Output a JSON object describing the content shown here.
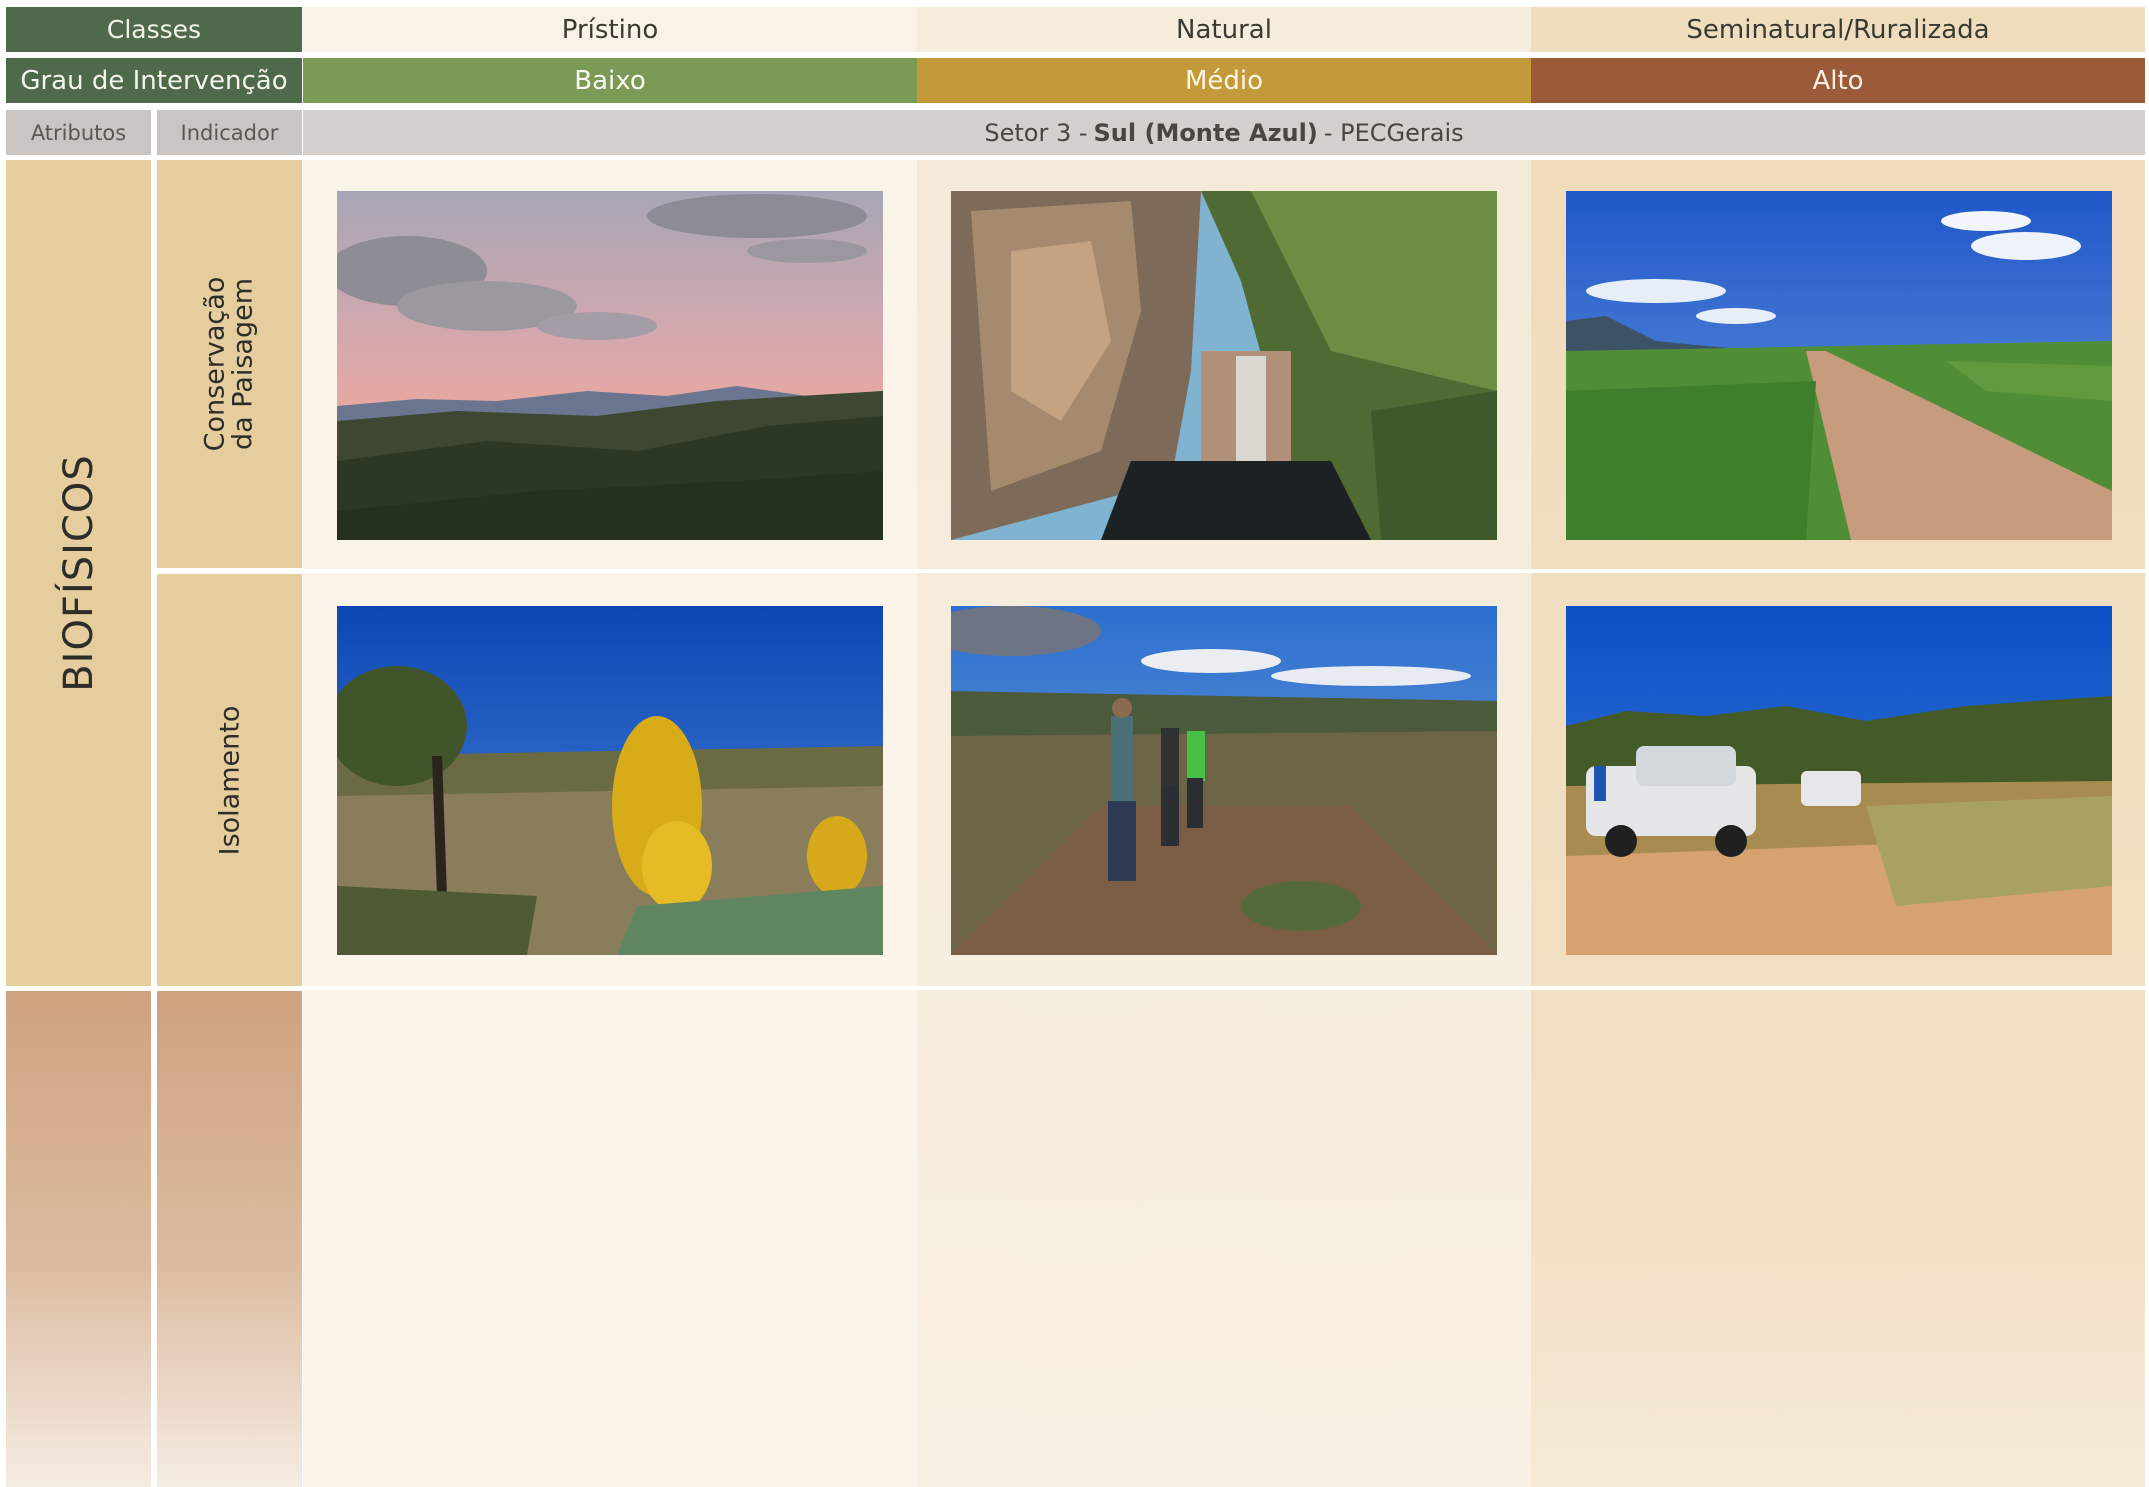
{
  "header": {
    "classes_label": "Classes",
    "classes": [
      "Prístino",
      "Natural",
      "Seminatural/Ruralizada"
    ],
    "grau_label": "Grau de Intervenção",
    "graus": [
      "Baixo",
      "Médio",
      "Alto"
    ],
    "atributos_label": "Atributos",
    "indicador_label": "Indicador",
    "setor": {
      "prefix": "Setor 3 -",
      "name": "Sul (Monte Azul)",
      "suffix": "- PECGerais"
    }
  },
  "attributes": [
    {
      "label": "BIOFÍSICOS"
    }
  ],
  "indicators": [
    {
      "line1": "Conservação",
      "line2": "da Paisagem"
    },
    {
      "label": "Isolamento"
    }
  ],
  "colors": {
    "header_green": "#4f6a4b",
    "baixo": "#7b9a55",
    "medio": "#c4993a",
    "alto": "#9b5a38",
    "attribute_cell": "#e5cd9d"
  },
  "photos": [
    {
      "scene": "sunset-landscape-icon"
    },
    {
      "scene": "waterfall-canyon-icon"
    },
    {
      "scene": "dirt-road-pasture-icon"
    },
    {
      "scene": "yellow-flowers-cerrado-icon"
    },
    {
      "scene": "hikers-trail-icon"
    },
    {
      "scene": "pickup-trucks-field-icon"
    }
  ]
}
